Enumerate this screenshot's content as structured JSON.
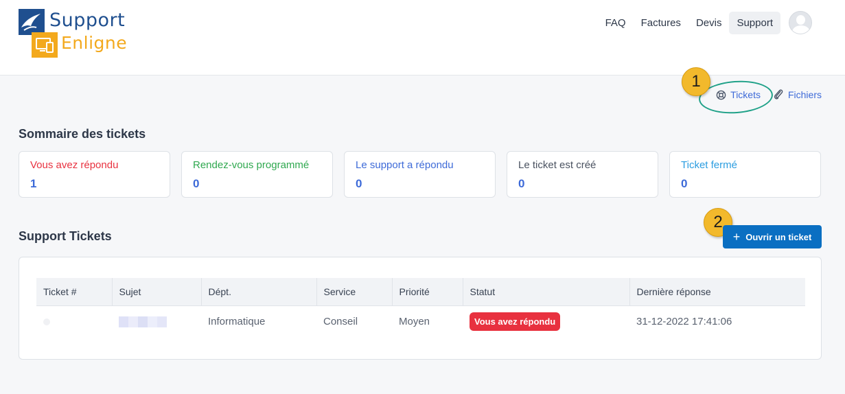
{
  "brand": {
    "line1": "Support",
    "line2": "Enligne",
    "colors": {
      "blue": "#1f4f8f",
      "orange": "#f3a91d"
    }
  },
  "nav": {
    "items": [
      {
        "label": "FAQ"
      },
      {
        "label": "Factures"
      },
      {
        "label": "Devis"
      },
      {
        "label": "Support",
        "active": true
      }
    ]
  },
  "sublinks": {
    "tickets": "Tickets",
    "files": "Fichiers"
  },
  "annotations": {
    "one": "1",
    "two": "2"
  },
  "summary": {
    "title": "Sommaire des tickets",
    "cards": [
      {
        "label": "Vous avez répondu",
        "value": "1",
        "color": "#e8313f"
      },
      {
        "label": "Rendez-vous programmé",
        "value": "0",
        "color": "#2fa84f"
      },
      {
        "label": "Le support a répondu",
        "value": "0",
        "color": "#3d6ad8"
      },
      {
        "label": "Le ticket est créé",
        "value": "0",
        "color": "#4a5260"
      },
      {
        "label": "Ticket fermé",
        "value": "0",
        "color": "#2b9de0"
      }
    ]
  },
  "tickets": {
    "title": "Support Tickets",
    "open_button": "Ouvrir un ticket",
    "columns": [
      "Ticket #",
      "Sujet",
      "Dépt.",
      "Service",
      "Priorité",
      "Statut",
      "Dernière réponse"
    ],
    "rows": [
      {
        "dept": "Informatique",
        "service": "Conseil",
        "priority": "Moyen",
        "status": "Vous avez répondu",
        "last_reply": "31-12-2022 17:41:06"
      }
    ]
  }
}
